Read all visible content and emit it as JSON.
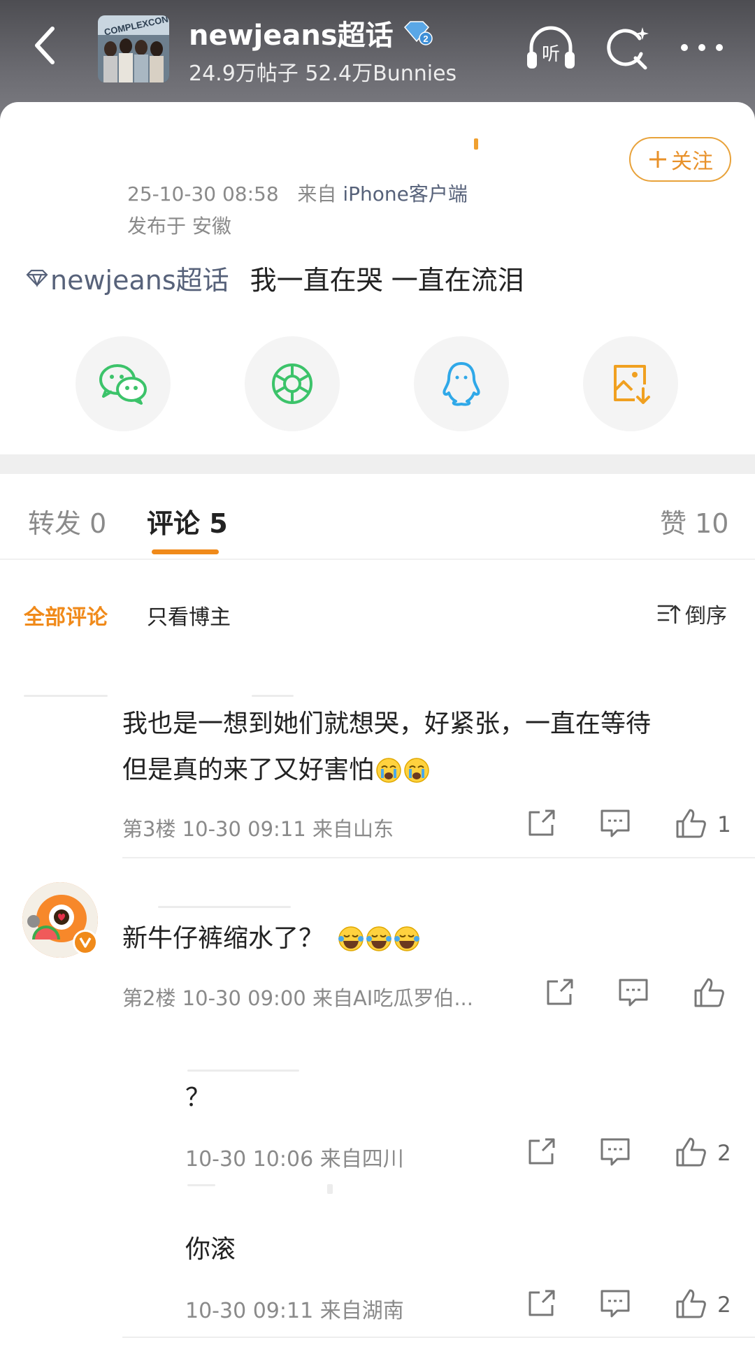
{
  "header": {
    "title": "newjeans超话",
    "level_badge": "2",
    "stats": "24.9万帖子 52.4万Bunnies",
    "listen_label": "听"
  },
  "post": {
    "follow_label": "关注",
    "time": "25-10-30 08:58",
    "source_prefix": "来自",
    "source": "iPhone客户端",
    "location": "发布于 安徽",
    "topic_tag": "newjeans超话",
    "text": "我一直在哭 一直在流泪"
  },
  "share": [
    {
      "icon": "wechat-icon",
      "color": "#3cc36a"
    },
    {
      "icon": "moments-icon",
      "color": "#3cc36a"
    },
    {
      "icon": "qq-icon",
      "color": "#2fa8e8"
    },
    {
      "icon": "save-image-icon",
      "color": "#f0a020"
    }
  ],
  "tabs": [
    {
      "label": "转发 0",
      "active": false
    },
    {
      "label": "评论 5",
      "active": true
    },
    {
      "label": "赞 10",
      "active": false
    }
  ],
  "filters": {
    "all": "全部评论",
    "author_only": "只看博主",
    "sort": "倒序"
  },
  "comments": [
    {
      "line1": "我也是一想到她们就想哭，好紧张，一直在等待",
      "line2": "但是真的来了又好害怕",
      "emojis": "😭😭",
      "meta": "第3楼 10-30 09:11 来自山东",
      "likes": "1"
    },
    {
      "text": "新牛仔裤缩水了？",
      "emojis": "😂😂😂",
      "meta": "第2楼 10-30 09:00 来自AI吃瓜罗伯...",
      "likes": ""
    },
    {
      "text": "？",
      "meta": "10-30 10:06 来自四川",
      "likes": "2"
    },
    {
      "text": "你滚",
      "meta": "10-30 09:11 来自湖南",
      "likes": "2"
    }
  ],
  "colors": {
    "accent": "#f08a1a",
    "link": "#57627a",
    "muted": "#8a8a8a"
  }
}
